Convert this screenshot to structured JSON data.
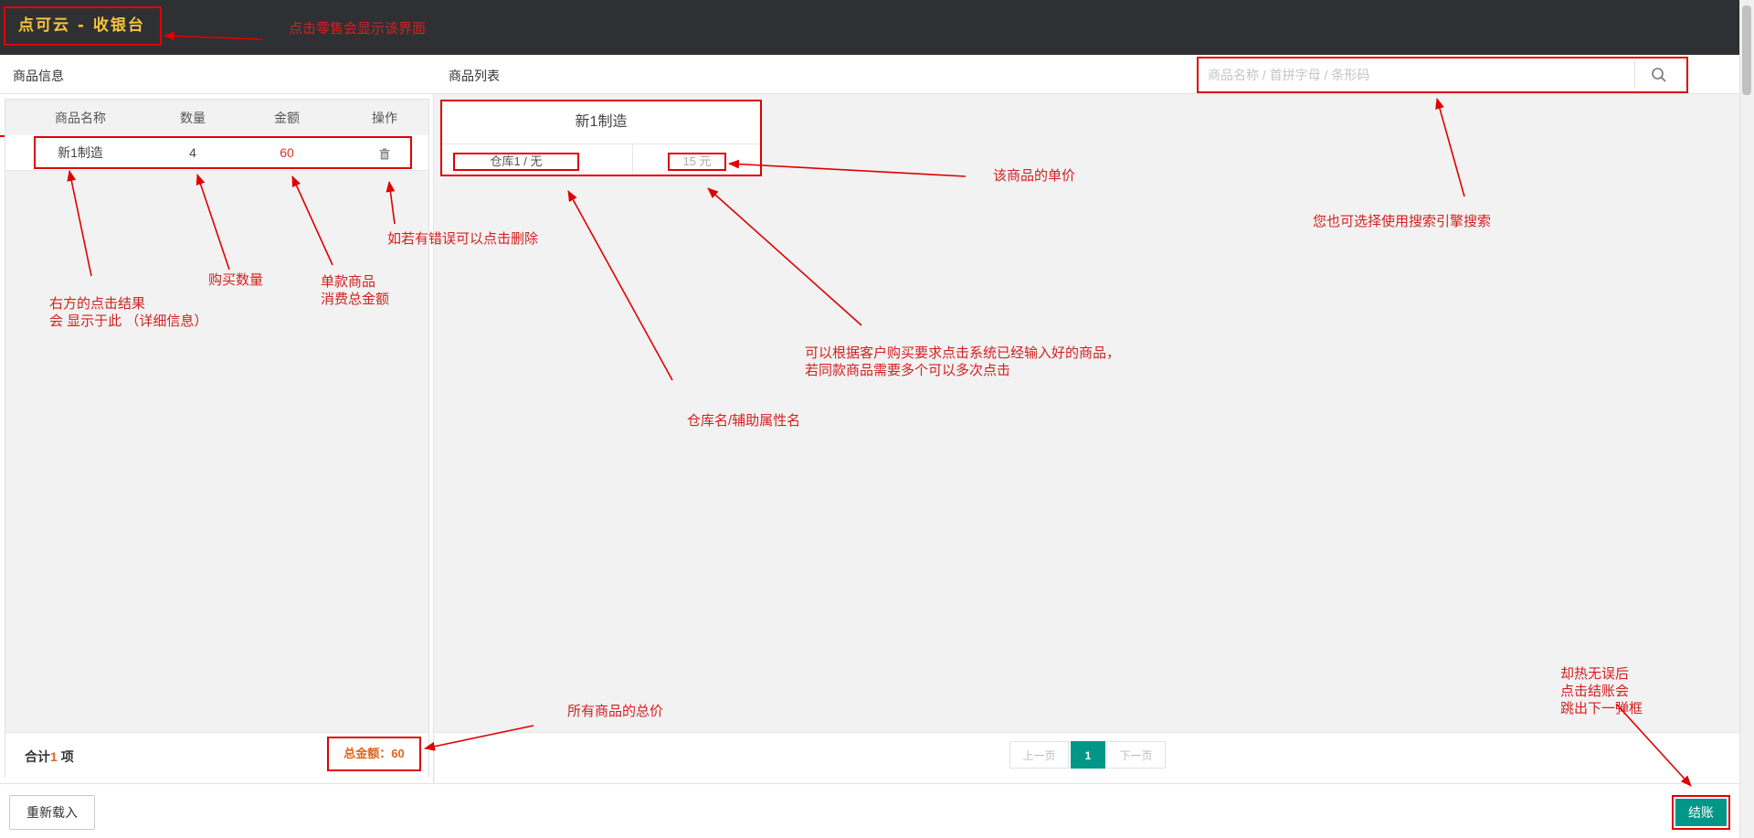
{
  "header": {
    "title": "点可云 - 收银台"
  },
  "left_panel": {
    "title": "商品信息",
    "columns": [
      "商品名称",
      "数量",
      "金额",
      "操作"
    ],
    "rows": [
      {
        "name": "新1制造",
        "qty": "4",
        "amount": "60"
      }
    ],
    "footer": {
      "summary_prefix": "合计",
      "count": "1",
      "summary_suffix": "项",
      "total_label": "总金额：",
      "total_value": "60"
    }
  },
  "right_panel": {
    "title": "商品列表",
    "search": {
      "placeholder": "商品名称 / 首拼字母 / 条形码"
    },
    "product": {
      "name": "新1制造",
      "warehouse": "仓库1 / 无",
      "price": "15 元"
    },
    "pagination": {
      "prev": "上一页",
      "current": "1",
      "next": "下一页"
    }
  },
  "bottom": {
    "reload": "重新载入",
    "checkout": "结账"
  },
  "annotations": {
    "brand": "点击零售会显示该界面",
    "details_1": "右方的点击结果",
    "details_2": "会 显示于此 （详细信息）",
    "qty": "购买数量",
    "amount_1": "单款商品",
    "amount_2": "消费总金额",
    "delete": "如若有错误可以点击删除",
    "price": "该商品的单价",
    "search": "您也可选择使用搜索引擎搜索",
    "click_1": "可以根据客户购买要求点击系统已经输入好的商品，",
    "click_2": "若同款商品需要多个可以多次点击",
    "warehouse": "仓库名/辅助属性名",
    "total": "所有商品的总价",
    "checkout_1": "却热无误后",
    "checkout_2": "点击结账会",
    "checkout_3": "跳出下一弹框"
  },
  "colors": {
    "topbar": "#2f3033",
    "brand_text": "#f6c33a",
    "accent": "#009688",
    "annotation": "#d42020",
    "total": "#e0641e"
  }
}
